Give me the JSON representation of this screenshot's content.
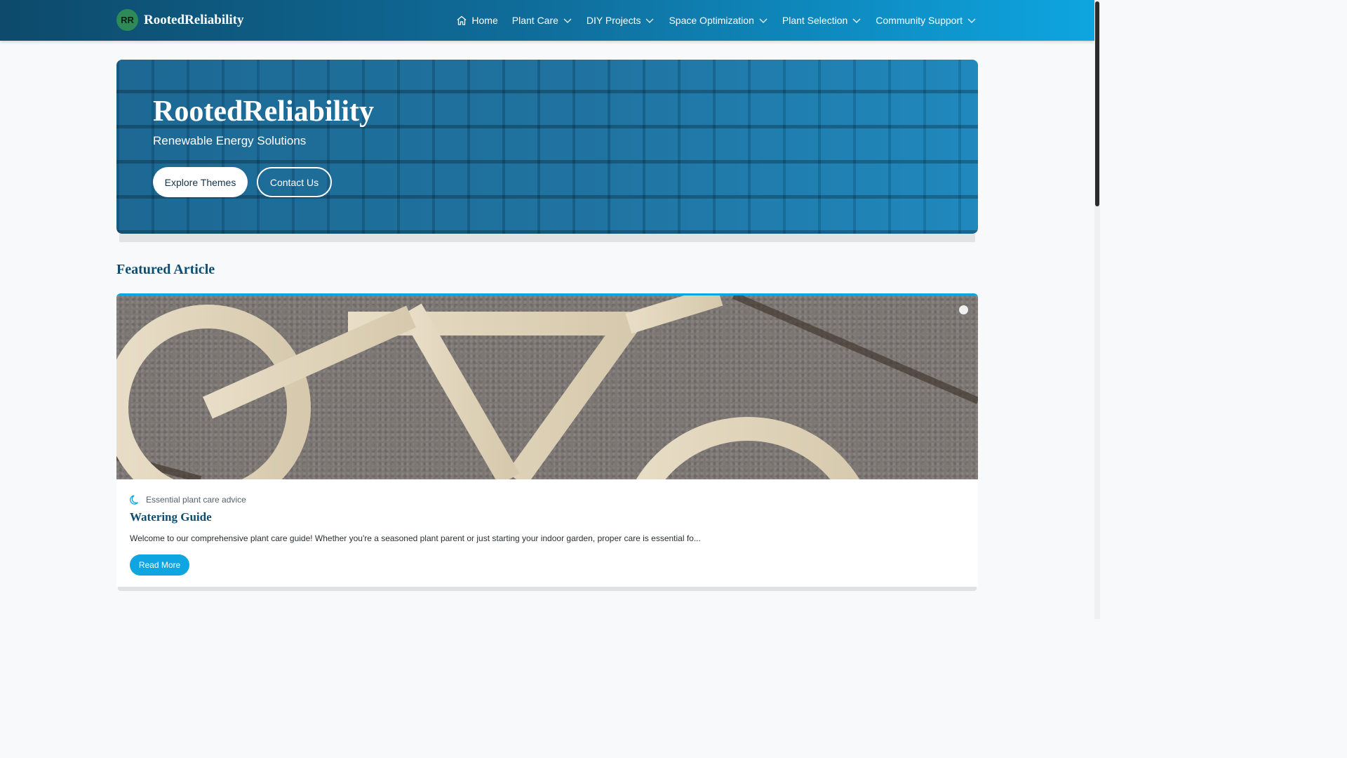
{
  "header": {
    "logo_initials": "RR",
    "brand": "RootedReliability",
    "nav": [
      {
        "label": "Home",
        "icon": "home-icon"
      },
      {
        "label": "Plant Care",
        "icon": "chevron-down-icon"
      },
      {
        "label": "DIY Projects",
        "icon": "chevron-down-icon"
      },
      {
        "label": "Space Optimization",
        "icon": "chevron-down-icon"
      },
      {
        "label": "Plant Selection",
        "icon": "chevron-down-icon"
      },
      {
        "label": "Community Support",
        "icon": "chevron-down-icon"
      }
    ]
  },
  "hero": {
    "title": "RootedReliability",
    "subtitle": "Renewable Energy Solutions",
    "primary_button": "Explore Themes",
    "secondary_button": "Contact Us"
  },
  "featured": {
    "section_title": "Featured Article",
    "category": "Essential plant care advice",
    "category_icon": "moon-icon",
    "title": "Watering Guide",
    "excerpt": "Welcome to our comprehensive plant care guide! Whether you're a seasoned plant parent or just starting your indoor garden, proper care is essential fo...",
    "button": "Read More"
  },
  "colors": {
    "header_start": "#0d4a6b",
    "header_end": "#0ea5e0",
    "accent": "#0ea5e0",
    "title_blue": "#0f4d70"
  }
}
